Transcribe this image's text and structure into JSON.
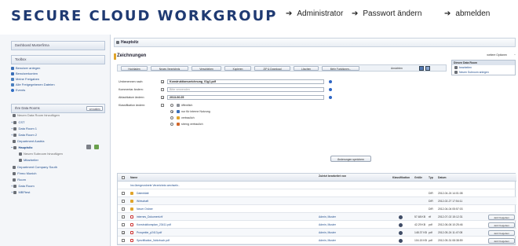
{
  "app": {
    "title": "SECURE CLOUD WORKGROUP"
  },
  "topnav": {
    "admin": "Administrator",
    "password": "Passwort ändern",
    "logout": "abmelden"
  },
  "sidebar": {
    "dashboard": "Dashboard Musterfirma",
    "toolbox": {
      "title": "Toolbox",
      "items": [
        "Benutzer anlegen",
        "Benutzerkonten",
        "Meine Freigaben",
        "Alle Freigegebenen Dateien",
        "Events"
      ]
    },
    "datarooms": {
      "title": "Ihre Data Rooms",
      "manage": "verwalten",
      "new_room": "Neuen Data Room hinzufügen",
      "tree": [
        {
          "label": "CST",
          "level": 0
        },
        {
          "label": "Data Room 1",
          "level": 0
        },
        {
          "label": "Data Room 2",
          "level": 0
        },
        {
          "label": "Department Austria",
          "level": 0
        },
        {
          "label": "Hauptsitz",
          "level": 0
        },
        {
          "label": "Neuen Subroom hinzufügen",
          "level": 1
        },
        {
          "label": "Mitarbeiter",
          "level": 1
        },
        {
          "label": "Department Company South",
          "level": 0
        },
        {
          "label": "Firmo Munich",
          "level": 0
        },
        {
          "label": "Room",
          "level": 0
        },
        {
          "label": "Data Room",
          "level": 0
        },
        {
          "label": "MBFtest",
          "level": 0
        }
      ]
    }
  },
  "breadcrumb": "Hauptsitz",
  "section_title": "Zeichnungen",
  "toolbar": {
    "buttons": [
      "Hochladen",
      "Neues Verzeichnis",
      "Verschieben",
      "Kopieren",
      "ZIP & Download",
      "Löschen",
      "Mehr Funktionen..."
    ],
    "view_label": "Ansichten"
  },
  "form": {
    "rename_label": "Umbenennen nach:",
    "rename_value": "Konstruktionszeichnung_01g1.pdf",
    "comment_label": "Kommentar ändern:",
    "comment_placeholder": "Bitte verwenden",
    "expiry_label": "Ablaufdatum ändern:",
    "expiry_value": "2013-06-05",
    "classification_label": "Klassifikation ändern:",
    "classifications": [
      "öffentlich",
      "nur für interne Nutzung",
      "vertraulich",
      "streng vertraulich"
    ],
    "selected_classification": 1,
    "save_button": "Änderungen speichern"
  },
  "options": {
    "header": "weitere Optionen",
    "menu_title": "Diesen Data Room",
    "items": [
      "bearbeiten",
      "Neuen Subroom anlegen"
    ]
  },
  "table": {
    "headers": {
      "name": "Name",
      "edited": "Zuletzt bearbeitet von",
      "classification": "Klassifikation",
      "size": "Größe",
      "type": "Typ",
      "date": "Datum"
    },
    "parent_link": "Ins übergeordnete Verzeichnis wechseln..",
    "rows": [
      {
        "name": "Datenblatt",
        "kind": "folder",
        "editor": "",
        "size": "",
        "type": "DIR",
        "date": "2012-04-24 14:01:08",
        "checked": false,
        "classif": false,
        "share": false
      },
      {
        "name": "Wirtschaft",
        "kind": "folder",
        "editor": "",
        "size": "",
        "type": "DIR",
        "date": "2012-02-27 17:54:11",
        "checked": false,
        "classif": false,
        "share": false
      },
      {
        "name": "Neuer Ordner",
        "kind": "folder",
        "editor": "",
        "size": "",
        "type": "DIR",
        "date": "2012-04-04 05:57:03",
        "checked": false,
        "classif": false,
        "share": false
      },
      {
        "name": "internes_Dokument.rtf",
        "kind": "doc",
        "editor": "Admin, Muster",
        "size": "57.68 KB",
        "type": "rtf",
        "date": "2012-07-02 15:12:31",
        "checked": false,
        "classif": true,
        "share": true
      },
      {
        "name": "Konstruktionsplan_23411.pdf",
        "kind": "doc",
        "editor": "Admin, Muster",
        "size": "42.29 KB",
        "type": "pdf",
        "date": "2012-06-06 10:25:46",
        "checked": false,
        "classif": true,
        "share": true
      },
      {
        "name": "Prospekte_p2413.pdf",
        "kind": "doc",
        "editor": "Admin, Muster",
        "size": "148.37 KB",
        "type": "pdf",
        "date": "2012-05-24 11:47:08",
        "checked": true,
        "classif": true,
        "share": true
      },
      {
        "name": "Spezifikation_Notizbuch.pdf",
        "kind": "doc",
        "editor": "Admin, Muster",
        "size": "104.15 KB",
        "type": "pdf",
        "date": "2012-05-31 08:38:59",
        "checked": false,
        "classif": true,
        "share": true
      }
    ],
    "share_button": "Jetzt freigeben"
  }
}
